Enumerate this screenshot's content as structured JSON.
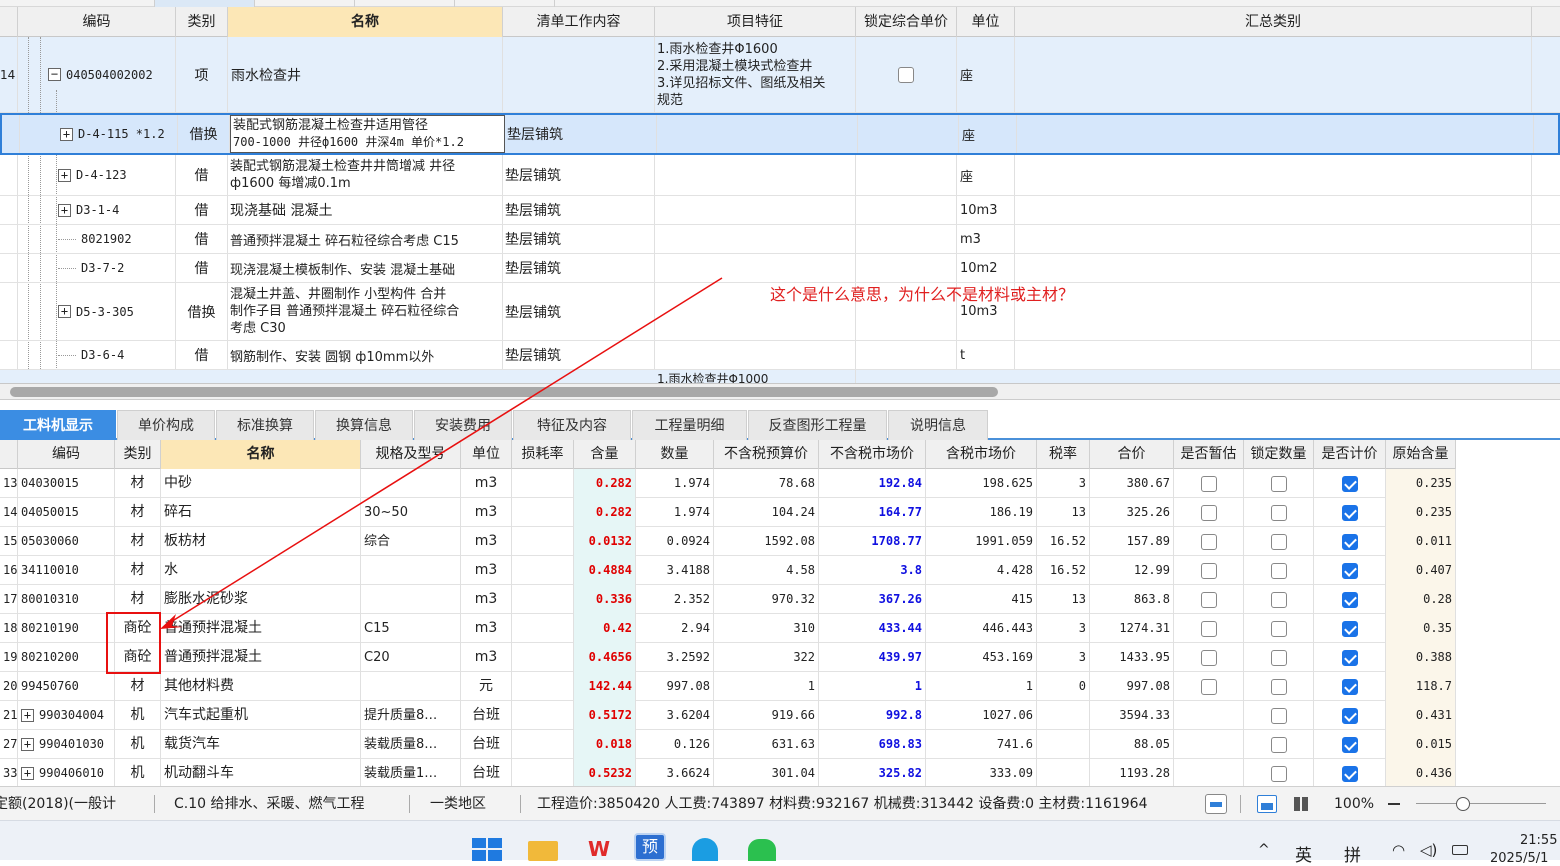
{
  "top_table": {
    "headers": [
      "编码",
      "类别",
      "名称",
      "清单工作内容",
      "项目特征",
      "锁定综合单价",
      "单位",
      "汇总类别"
    ],
    "rows": [
      {
        "num": "14",
        "code": "040504002002",
        "type": "项",
        "name": "雨水检查井",
        "work": "",
        "feature": [
          "1.雨水检查井Φ1600",
          "2.采用混凝土模块式检查井",
          "3.详见招标文件、图纸及相关",
          "规范"
        ],
        "locked": false,
        "unit": "座"
      },
      {
        "code": "D-4-115 *1.2",
        "type": "借换",
        "name": [
          "装配式钢筋混凝土检查井适用管径",
          "700-1000 井径ф1600 井深4m 单价*1.2"
        ],
        "work": "垫层铺筑",
        "unit": "座"
      },
      {
        "code": "D-4-123",
        "type": "借",
        "name": [
          "装配式钢筋混凝土检查井井筒增减 井径",
          "ф1600 每增减0.1m"
        ],
        "work": "垫层铺筑",
        "unit": "座"
      },
      {
        "code": "D3-1-4",
        "type": "借",
        "name": [
          "现浇基础 混凝土"
        ],
        "work": "垫层铺筑",
        "unit": "10m3"
      },
      {
        "code": "8021902",
        "type": "借",
        "name": [
          "普通预拌混凝土 碎石粒径综合考虑 C15"
        ],
        "work": "垫层铺筑",
        "unit": "m3"
      },
      {
        "code": "D3-7-2",
        "type": "借",
        "name": [
          "现浇混凝土模板制作、安装 混凝土基础"
        ],
        "work": "垫层铺筑",
        "unit": "10m2"
      },
      {
        "code": "D5-3-305",
        "type": "借换",
        "name": [
          "混凝土井盖、井圈制作 小型构件  合并",
          "制作子目 普通预拌混凝土 碎石粒径综合",
          "考虑 C30"
        ],
        "work": "垫层铺筑",
        "unit": "10m3"
      },
      {
        "code": "D3-6-4",
        "type": "借",
        "name": [
          "钢筋制作、安装 圆钢 ф10mm以外"
        ],
        "work": "垫层铺筑",
        "unit": "t"
      }
    ],
    "partial_row_text": "1.雨水检查井Φ1000"
  },
  "annotation": "这个是什么意思，为什么不是材料或主材？",
  "tabs": [
    "工料机显示",
    "单价构成",
    "标准换算",
    "换算信息",
    "安装费用",
    "特征及内容",
    "工程量明细",
    "反查图形工程量",
    "说明信息"
  ],
  "bottom_table": {
    "headers": [
      "编码",
      "类别",
      "名称",
      "规格及型号",
      "单位",
      "损耗率",
      "含量",
      "数量",
      "不含税预算价",
      "不含税市场价",
      "含税市场价",
      "税率",
      "合价",
      "是否暂估",
      "锁定数量",
      "是否计价",
      "原始含量"
    ],
    "rows": [
      {
        "num": "13",
        "code": "04030015",
        "type": "材",
        "name": "中砂",
        "spec": "",
        "unit": "m3",
        "loss": "",
        "content": "0.282",
        "qty": "1.974",
        "budget": "78.68",
        "market": "192.84",
        "taxmarket": "198.625",
        "rate": "3",
        "total": "380.67",
        "est": false,
        "lockq": false,
        "priced": true,
        "orig": "0.235"
      },
      {
        "num": "14",
        "code": "04050015",
        "type": "材",
        "name": "碎石",
        "spec": "30~50",
        "unit": "m3",
        "loss": "",
        "content": "0.282",
        "qty": "1.974",
        "budget": "104.24",
        "market": "164.77",
        "taxmarket": "186.19",
        "rate": "13",
        "total": "325.26",
        "est": false,
        "lockq": false,
        "priced": true,
        "orig": "0.235"
      },
      {
        "num": "15",
        "code": "05030060",
        "type": "材",
        "name": "板枋材",
        "spec": "综合",
        "unit": "m3",
        "loss": "",
        "content": "0.0132",
        "qty": "0.0924",
        "budget": "1592.08",
        "market": "1708.77",
        "taxmarket": "1991.059",
        "rate": "16.52",
        "total": "157.89",
        "est": false,
        "lockq": false,
        "priced": true,
        "orig": "0.011"
      },
      {
        "num": "16",
        "code": "34110010",
        "type": "材",
        "name": "水",
        "spec": "",
        "unit": "m3",
        "loss": "",
        "content": "0.4884",
        "qty": "3.4188",
        "budget": "4.58",
        "market": "3.8",
        "taxmarket": "4.428",
        "rate": "16.52",
        "total": "12.99",
        "est": false,
        "lockq": false,
        "priced": true,
        "orig": "0.407"
      },
      {
        "num": "17",
        "code": "80010310",
        "type": "材",
        "name": "膨胀水泥砂浆",
        "spec": "",
        "unit": "m3",
        "loss": "",
        "content": "0.336",
        "qty": "2.352",
        "budget": "970.32",
        "market": "367.26",
        "taxmarket": "415",
        "rate": "13",
        "total": "863.8",
        "est": false,
        "lockq": false,
        "priced": true,
        "orig": "0.28"
      },
      {
        "num": "18",
        "code": "80210190",
        "type": "商砼",
        "name": "普通预拌混凝土",
        "spec": "C15",
        "unit": "m3",
        "loss": "",
        "content": "0.42",
        "qty": "2.94",
        "budget": "310",
        "market": "433.44",
        "taxmarket": "446.443",
        "rate": "3",
        "total": "1274.31",
        "est": false,
        "lockq": false,
        "priced": true,
        "orig": "0.35"
      },
      {
        "num": "19",
        "code": "80210200",
        "type": "商砼",
        "name": "普通预拌混凝土",
        "spec": "C20",
        "unit": "m3",
        "loss": "",
        "content": "0.4656",
        "qty": "3.2592",
        "budget": "322",
        "market": "439.97",
        "taxmarket": "453.169",
        "rate": "3",
        "total": "1433.95",
        "est": false,
        "lockq": false,
        "priced": true,
        "orig": "0.388"
      },
      {
        "num": "20",
        "code": "99450760",
        "type": "材",
        "name": "其他材料费",
        "spec": "",
        "unit": "元",
        "loss": "",
        "content": "142.44",
        "qty": "997.08",
        "budget": "1",
        "market": "1",
        "taxmarket": "1",
        "rate": "0",
        "total": "997.08",
        "est": false,
        "lockq": false,
        "priced": true,
        "orig": "118.7"
      },
      {
        "num": "21",
        "code": "990304004",
        "type": "机",
        "name": "汽车式起重机",
        "spec": "提升质量8…",
        "unit": "台班",
        "loss": "",
        "content": "0.5172",
        "qty": "3.6204",
        "budget": "919.66",
        "market": "992.8",
        "taxmarket": "1027.06",
        "rate": "",
        "total": "3594.33",
        "est": null,
        "lockq": false,
        "priced": true,
        "orig": "0.431",
        "expand": true
      },
      {
        "num": "27",
        "code": "990401030",
        "type": "机",
        "name": "载货汽车",
        "spec": "装载质量8…",
        "unit": "台班",
        "loss": "",
        "content": "0.018",
        "qty": "0.126",
        "budget": "631.63",
        "market": "698.83",
        "taxmarket": "741.6",
        "rate": "",
        "total": "88.05",
        "est": null,
        "lockq": false,
        "priced": true,
        "orig": "0.015",
        "expand": true
      },
      {
        "num": "33",
        "code": "990406010",
        "type": "机",
        "name": "机动翻斗车",
        "spec": "装载质量1…",
        "unit": "台班",
        "loss": "",
        "content": "0.5232",
        "qty": "3.6624",
        "budget": "301.04",
        "market": "325.82",
        "taxmarket": "333.09",
        "rate": "",
        "total": "1193.28",
        "est": null,
        "lockq": false,
        "priced": true,
        "orig": "0.436",
        "expand": true
      }
    ]
  },
  "status": {
    "quota": "定额(2018)(一般计",
    "category": "C.10 给排水、采暖、燃气工程",
    "region": "一类地区",
    "summary": "工程造价:3850420 人工费:743897 材料费:932167 机械费:313442 设备费:0 主材费:1161964",
    "zoom": "100%"
  },
  "taskbar": {
    "ime1": "英",
    "ime2": "拼",
    "time": "21:55",
    "date": "2025/5/1"
  },
  "colors": {
    "accent": "#3b8de3",
    "highlight_header": "#fce7b6",
    "annotation": "#e02020",
    "selected_row": "#d6e7fb"
  }
}
